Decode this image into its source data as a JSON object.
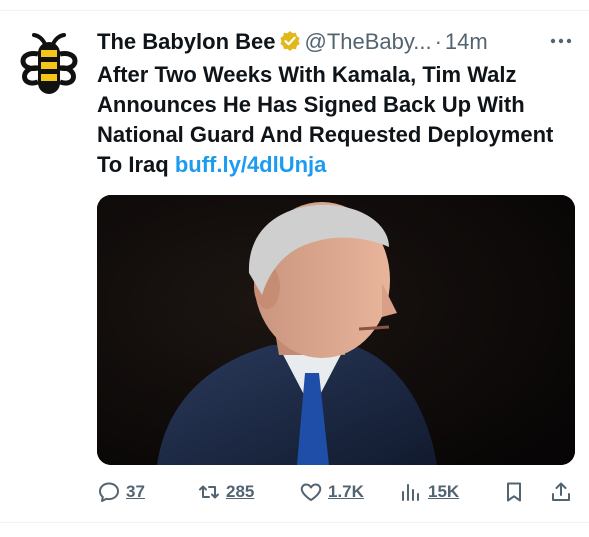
{
  "tweet": {
    "author_name": "The Babylon Bee",
    "handle": "@TheBaby...",
    "separator": "·",
    "timestamp": "14m",
    "text": "After Two Weeks With Kamala, Tim Walz Announces He Has Signed Back Up With National Guard And Requested Deployment To Iraq",
    "link_text": "buff.ly/4dlUnja",
    "verified_badge": "verified-badge-icon",
    "more_icon": "more-options-icon"
  },
  "actions": {
    "replies": "37",
    "reposts": "285",
    "likes": "1.7K",
    "views": "15K"
  },
  "colors": {
    "link": "#1d9bf0",
    "secondary_text": "#536471",
    "verified_gold": "#e2b719",
    "bee_yellow": "#f5c518"
  }
}
